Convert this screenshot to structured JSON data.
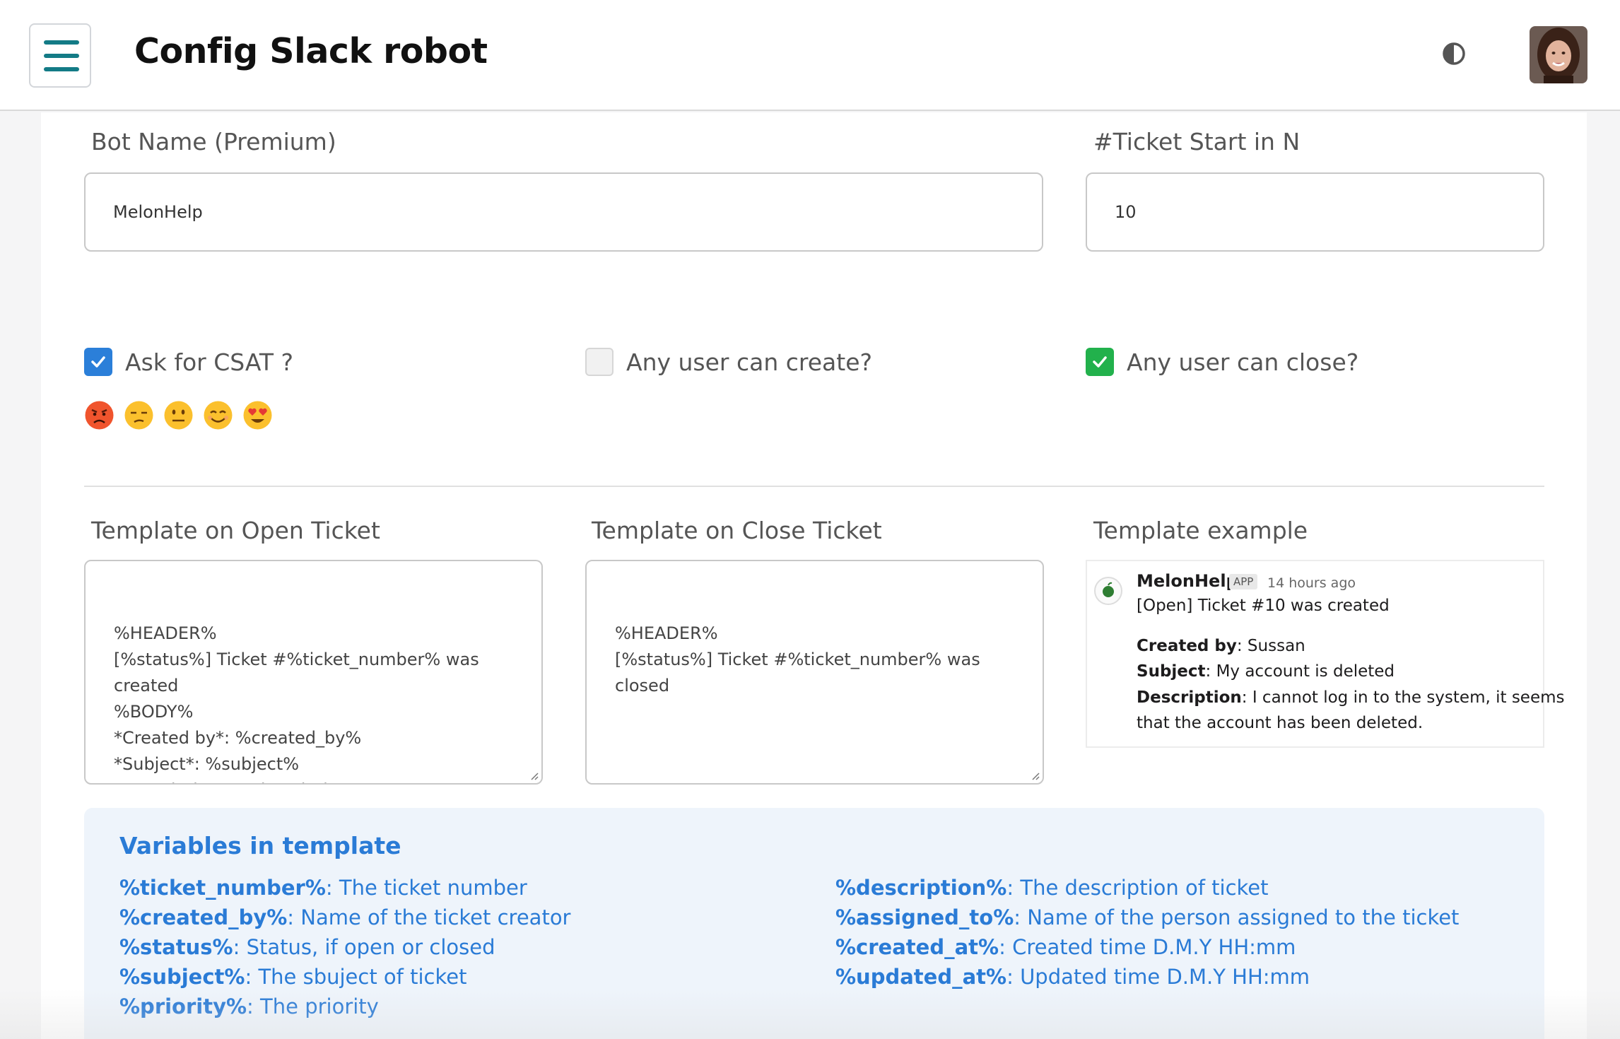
{
  "header": {
    "title": "Config Slack robot",
    "menu_icon": "hamburger-menu-icon",
    "theme_icon": "contrast-icon",
    "avatar_icon": "user-avatar"
  },
  "form": {
    "bot_name": {
      "label": "Bot Name (Premium)",
      "value": "MelonHelp"
    },
    "ticket_start": {
      "label": "#Ticket Start in N",
      "value": "10"
    },
    "checks": {
      "csat": {
        "label": "Ask for CSAT ?",
        "checked": true
      },
      "create": {
        "label": "Any user can create?",
        "checked": false
      },
      "close": {
        "label": "Any user can close?",
        "checked": true
      }
    },
    "csat_emojis": [
      "angry-face",
      "unamused-face",
      "neutral-face",
      "smiling-face",
      "heart-eyes-face"
    ]
  },
  "templates": {
    "open": {
      "label": "Template on Open Ticket",
      "value": "%HEADER%\n[%status%] Ticket #%ticket_number% was\ncreated\n%BODY%\n*Created by*: %created_by%\n*Subject*: %subject%\n*Description*: %description%"
    },
    "close": {
      "label": "Template on Close Ticket",
      "value": "%HEADER%\n[%status%] Ticket #%ticket_number% was\nclosed"
    },
    "example": {
      "label": "Template example",
      "bot_name": "MelonHelp",
      "badge": "APP",
      "time": "14 hours ago",
      "headline": "[Open] Ticket #10 was created",
      "created_by_label": "Created by",
      "created_by": ": Sussan",
      "subject_label": "Subject",
      "subject": ": My account is deleted",
      "description_label": "Description",
      "description_1": ": I cannot log in to the system, it seems",
      "description_2": "that the account has been deleted."
    }
  },
  "variables": {
    "title": "Variables in template",
    "left": [
      {
        "key": "%ticket_number%",
        "desc": ": The ticket number"
      },
      {
        "key": "%created_by%",
        "desc": ": Name of the ticket creator"
      },
      {
        "key": "%status%",
        "desc": ": Status, if open or closed"
      },
      {
        "key": "%subject%",
        "desc": ": The sbuject of ticket"
      },
      {
        "key": "%priority%",
        "desc": ": The priority"
      }
    ],
    "right": [
      {
        "key": "%description%",
        "desc": ": The description of ticket"
      },
      {
        "key": "%assigned_to%",
        "desc": ": Name of the person assigned to the ticket"
      },
      {
        "key": "%created_at%",
        "desc": ": Created time D.M.Y HH:mm"
      },
      {
        "key": "%updated_at%",
        "desc": ": Updated time D.M.Y HH:mm"
      }
    ]
  }
}
